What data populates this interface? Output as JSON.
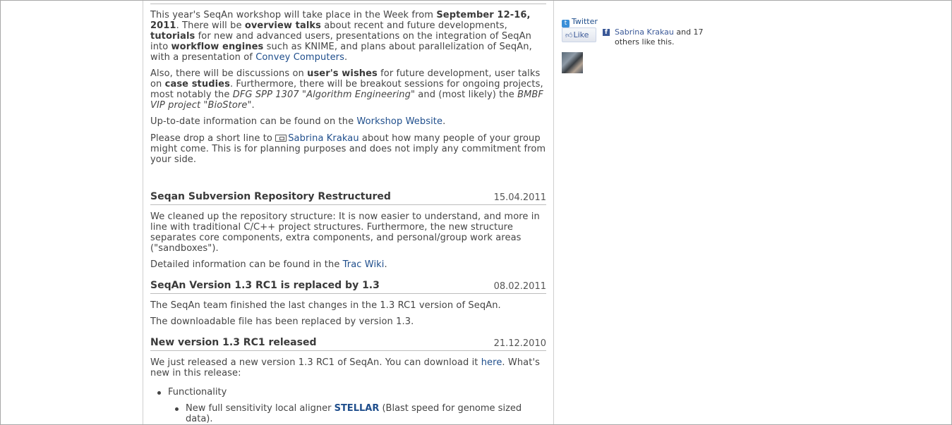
{
  "workshop": {
    "p1": {
      "t1": "This year's SeqAn workshop will take place in the Week from ",
      "b1": "September 12-16, 2011",
      "t2": ". There will be ",
      "b2": "overview talks",
      "t3": " about recent and future developments, ",
      "b3": "tutorials",
      "t4": " for new and advanced users, presentations on the integration of SeqAn into ",
      "b4": "workflow engines",
      "t5": " such as KNIME, and plans about parallelization of SeqAn, with a presentation of ",
      "link": "Convey Computers",
      "t6": "."
    },
    "p2": {
      "t1": "Also, there will be discussions on ",
      "b1": "user's wishes",
      "t2": " for future development, user talks on ",
      "b2": "case studies",
      "t3": ". Furthermore, there will be breakout sessions for ongoing projects, most notably the ",
      "i1": "DFG SPP 1307 \"Algorithm Engineering\"",
      "t4": " and (most likely) the ",
      "i2": "BMBF VIP project \"BioStore\"",
      "t5": "."
    },
    "p3": {
      "t1": "Up-to-date information can be found on the ",
      "link": "Workshop Website",
      "t2": "."
    },
    "p4": {
      "t1": "Please drop a short line to ",
      "link": "Sabrina Krakau",
      "t2": " about how many people of your group might come. This is for planning purposes and does not imply any commitment from your side."
    }
  },
  "news": [
    {
      "title": "Seqan Subversion Repository Restructured",
      "date": "15.04.2011",
      "p1": "We cleaned up the repository structure: It is now easier to understand, and more in line with traditional C/C++ project structures. Furthermore, the new structure separates core components, extra components, and personal/group work areas (\"sandboxes\").",
      "p2_t1": "Detailed information can be found in the ",
      "p2_link": "Trac Wiki",
      "p2_t2": "."
    },
    {
      "title": "SeqAn Version 1.3 RC1 is replaced by 1.3",
      "date": "08.02.2011",
      "p1": "The SeqAn team finished the last changes in the 1.3 RC1 version of SeqAn.",
      "p2": "The downloadable file has been replaced by version 1.3."
    },
    {
      "title": "New version 1.3 RC1 released",
      "date": "21.12.2010",
      "p1_t1": "We just released a new version 1.3 RC1 of SeqAn. You can download it ",
      "p1_link": "here",
      "p1_t2": ". What's new in this release:",
      "list_item": "Functionality",
      "sub_t1": "New full sensitivity local aligner ",
      "sub_link": "STELLAR",
      "sub_t2": " (Blast speed for genome sized data)."
    }
  ],
  "sidebar": {
    "twitter_label": "Twitter",
    "like_label": "Like",
    "like_name": "Sabrina Krakau",
    "like_rest": " and 17 others like this."
  }
}
